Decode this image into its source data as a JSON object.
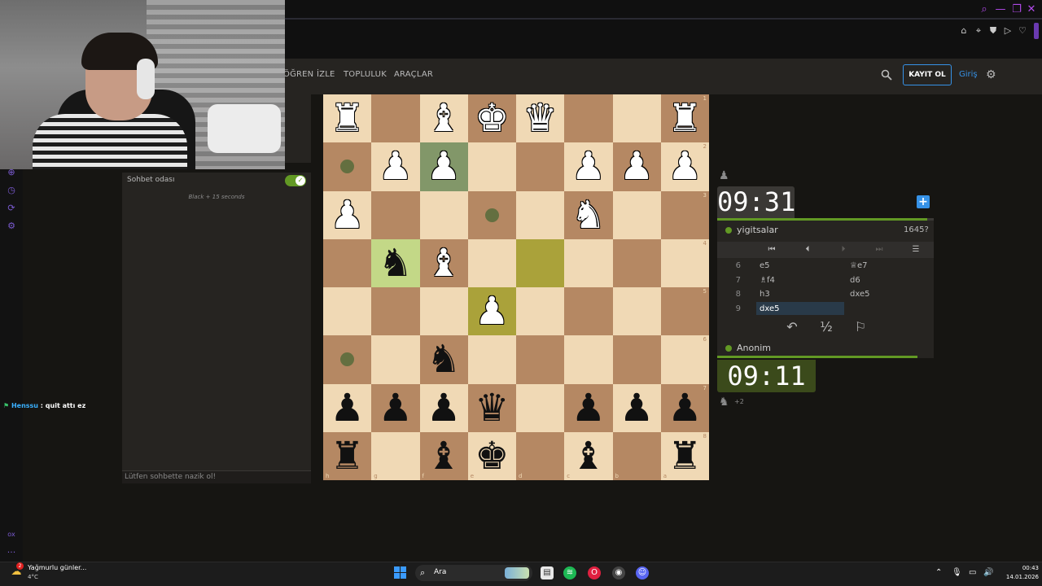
{
  "browser": {
    "controls": [
      "⌕",
      "—",
      "❐",
      "✕"
    ],
    "extensions": [
      "⌂",
      "⌖",
      "⛊",
      "▷",
      "♡"
    ]
  },
  "nav": {
    "items": [
      "ÖĞREN",
      "İZLE",
      "TOPLULUK",
      "ARAÇLAR"
    ],
    "signup": "KAYIT OL",
    "login": "Giriş"
  },
  "chat": {
    "title": "Sohbet odası",
    "meta": "Black + 15 seconds",
    "placeholder": "Lütfen sohbette nazik ol!"
  },
  "stream_chat": {
    "user": "Henssu",
    "separator": " : ",
    "message": "quit attı ez"
  },
  "board": {
    "rank_labels": [
      "1",
      "2",
      "3",
      "4",
      "5",
      "6",
      "7",
      "8"
    ],
    "file_labels": [
      "h",
      "g",
      "f",
      "e",
      "d",
      "c",
      "b",
      "a"
    ],
    "squares": [
      [
        "wR",
        "",
        "wB",
        "wK",
        "wQ",
        "",
        "",
        "wR"
      ],
      [
        "dot",
        "wP",
        "wP",
        "",
        "",
        "wP",
        "wP",
        "wP"
      ],
      [
        "wP",
        "",
        "",
        "dot",
        "",
        "wN",
        "",
        ""
      ],
      [
        "",
        "bN",
        "wB",
        "",
        "",
        "",
        "",
        ""
      ],
      [
        "",
        "",
        "",
        "wP",
        "",
        "",
        "",
        ""
      ],
      [
        "dot",
        "",
        "bN",
        "",
        "",
        "",
        "",
        ""
      ],
      [
        "bP",
        "bP",
        "bP",
        "bQ",
        "",
        "bP",
        "bP",
        "bP"
      ],
      [
        "bR",
        "",
        "bB",
        "bK",
        "",
        "bB",
        "",
        "bR"
      ]
    ],
    "selected": [
      [
        1,
        2
      ],
      [
        3,
        1
      ]
    ],
    "last_move": [
      [
        3,
        4
      ],
      [
        4,
        3
      ]
    ],
    "pieces": {
      "wK": "♚",
      "wQ": "♛",
      "wR": "♜",
      "wB": "♝",
      "wN": "♞",
      "wP": "♟",
      "bK": "♚",
      "bQ": "♛",
      "bR": "♜",
      "bB": "♝",
      "bN": "♞",
      "bP": "♟"
    }
  },
  "players": {
    "top": {
      "name": "yigitsalar",
      "rating": "1645?",
      "clock": "09:31",
      "material_icon": "♟"
    },
    "bottom": {
      "name": "Anonim",
      "clock": "09:11",
      "material_icon": "♞",
      "material_diff": "+2"
    }
  },
  "moves": [
    {
      "num": "6",
      "white": "e5",
      "black": "♕e7"
    },
    {
      "num": "7",
      "white": "♗f4",
      "black": "d6"
    },
    {
      "num": "8",
      "white": "h3",
      "black": "dxe5"
    },
    {
      "num": "9",
      "white": "dxe5",
      "black": ""
    }
  ],
  "move_nav": [
    "⏮",
    "⏴",
    "⏵",
    "⏭",
    "☰"
  ],
  "actions": {
    "takeback": "↶",
    "draw": "½",
    "resign": "⚐",
    "plus": "+"
  },
  "taskbar": {
    "weather": "Yağmurlu günler...",
    "temp": "4°C",
    "weather_badge": "2",
    "search": "Ara",
    "time": "00:43",
    "date": "14.01.2026",
    "tray": [
      "⌃",
      "🎙",
      "▭",
      "🔊"
    ]
  },
  "side": {
    "label": "ox",
    "dots": "···"
  },
  "colors": {
    "accent": "#3692e7",
    "green": "#629924",
    "board_light": "#f0d9b5",
    "board_dark": "#b58863"
  }
}
